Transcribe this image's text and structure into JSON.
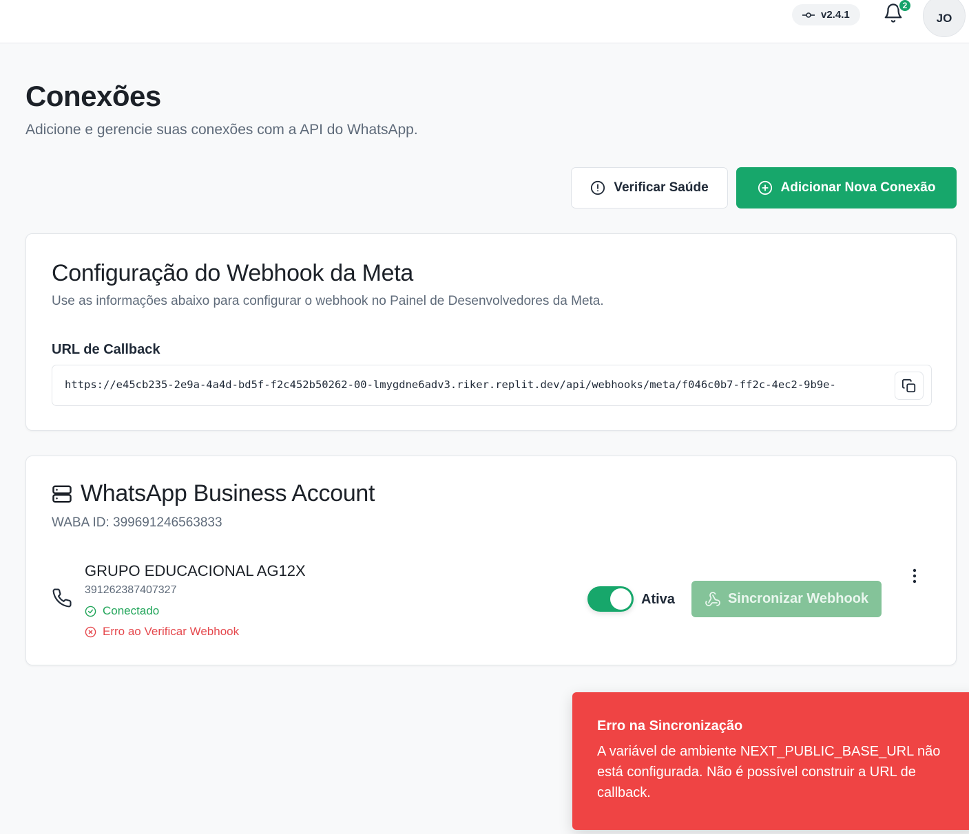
{
  "header": {
    "version": "v2.4.1",
    "notification_count": "2",
    "avatar_initials": "JO"
  },
  "page": {
    "title": "Conexões",
    "subtitle": "Adicione e gerencie suas conexões com a API do WhatsApp."
  },
  "actions": {
    "check_health_label": "Verificar Saúde",
    "add_connection_label": "Adicionar Nova Conexão"
  },
  "webhook_card": {
    "title": "Configuração do Webhook da Meta",
    "description": "Use as informações abaixo para configurar o webhook no Painel de Desenvolvedores da Meta.",
    "callback_label": "URL de Callback",
    "callback_url": "https://e45cb235-2e9a-4a4d-bd5f-f2c452b50262-00-lmygdne6adv3.riker.replit.dev/api/webhooks/meta/f046c0b7-ff2c-4ec2-9b9e-"
  },
  "waba_card": {
    "title": "WhatsApp Business Account",
    "waba_id": "WABA ID: 399691246563833",
    "connection": {
      "name": "GRUPO EDUCACIONAL AG12X",
      "phone_id": "391262387407327",
      "status_connected": "Conectado",
      "status_webhook_error": "Erro ao Verificar Webhook",
      "toggle_label": "Ativa",
      "toggle_on": true,
      "sync_label": "Sincronizar Webhook"
    }
  },
  "toast": {
    "title": "Erro na Sincronização",
    "message": "A variável de ambiente NEXT_PUBLIC_BASE_URL não está configurada. Não é possível construir a URL de callback."
  },
  "colors": {
    "primary": "#17a76b",
    "success": "#22a55a",
    "error": "#e5484d",
    "toast_bg": "#ef4444"
  }
}
